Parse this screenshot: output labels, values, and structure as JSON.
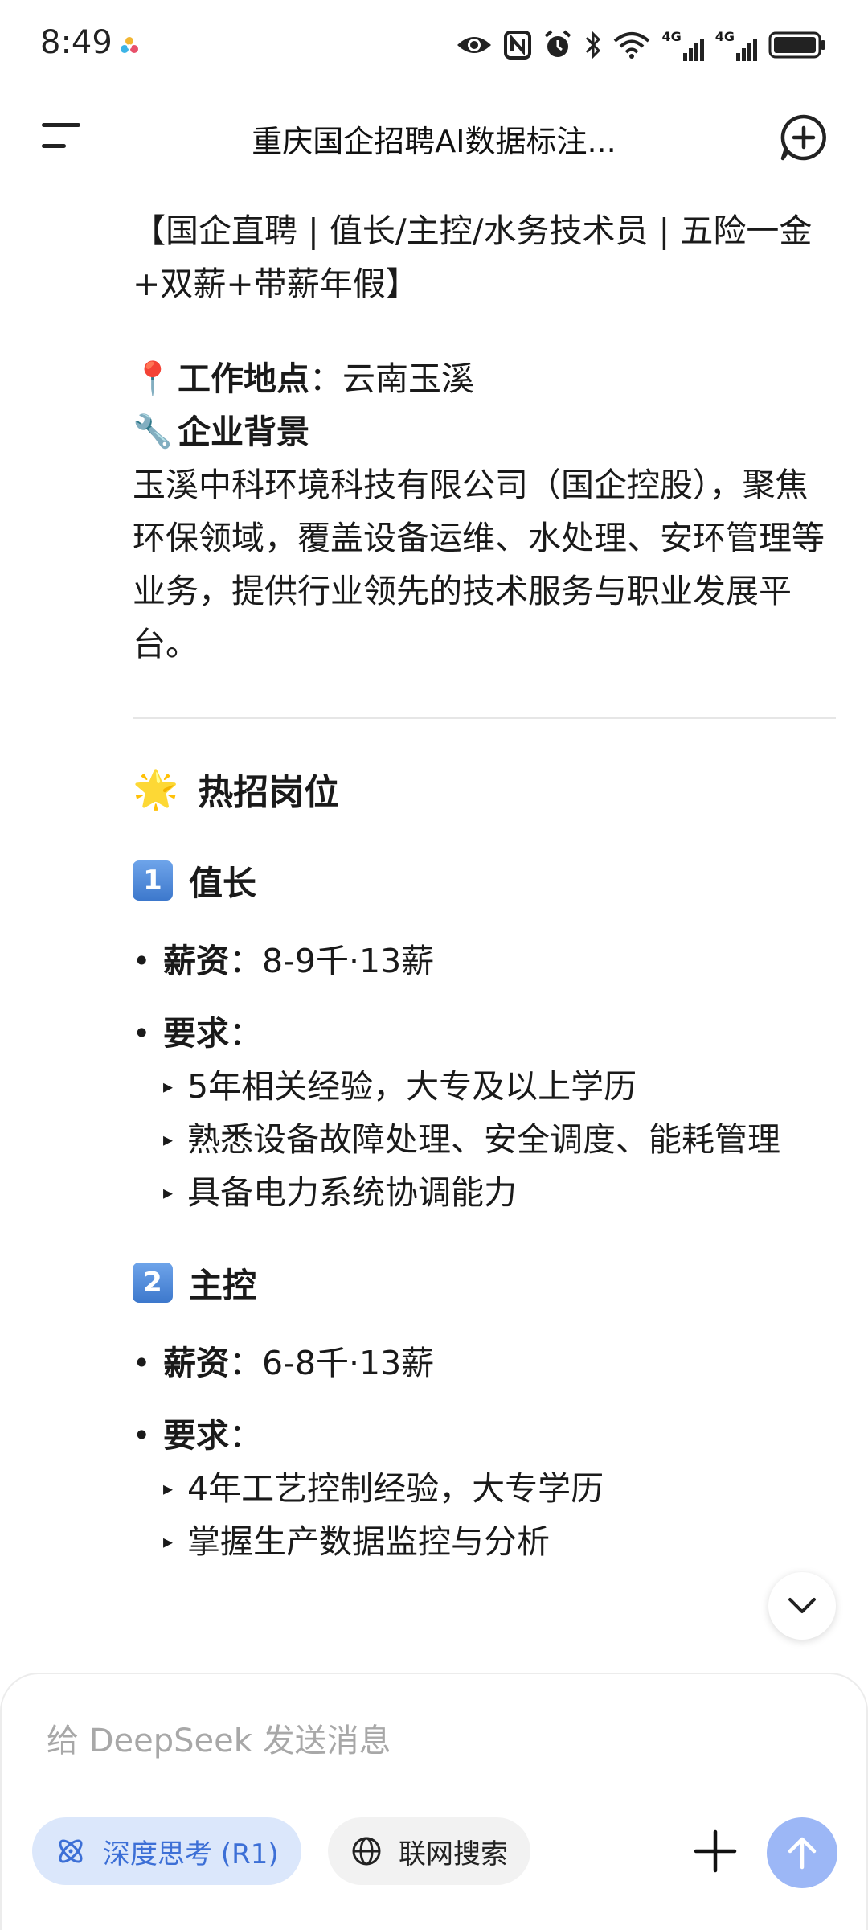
{
  "status_bar": {
    "time": "8:49",
    "icons": [
      "eye-icon",
      "nfc-icon",
      "alarm-icon",
      "bluetooth-icon",
      "wifi-icon",
      "signal-4g-icon",
      "signal-4g-icon",
      "battery-icon"
    ],
    "network_labels": [
      "4G",
      "4G"
    ]
  },
  "header": {
    "title": "重庆国企招聘AI数据标注..."
  },
  "content": {
    "headline": "【国企直聘 | 值长/主控/水务技术员 | 五险一金+双薪+带薪年假】",
    "location_label": "工作地点",
    "location_value": "：云南玉溪",
    "background_label": "企业背景",
    "background_text": "玉溪中科环境科技有限公司（国企控股），聚焦环保领域，覆盖设备运维、水处理、安环管理等业务，提供行业领先的技术服务与职业发展平台。",
    "hot_title": "热招岗位",
    "positions": [
      {
        "num": "1",
        "title": "值长",
        "salary_label": "薪资",
        "salary_value": "：8-9千·13薪",
        "req_label": "要求",
        "req_colon": "：",
        "requirements": [
          "5年相关经验，大专及以上学历",
          "熟悉设备故障处理、安全调度、能耗管理",
          "具备电力系统协调能力"
        ]
      },
      {
        "num": "2",
        "title": "主控",
        "salary_label": "薪资",
        "salary_value": "：6-8千·13薪",
        "req_label": "要求",
        "req_colon": "：",
        "requirements": [
          "4年工艺控制经验，大专学历",
          "掌握生产数据监控与分析"
        ]
      }
    ]
  },
  "input": {
    "placeholder": "给 DeepSeek 发送消息",
    "deep_think_label": "深度思考 (R1)",
    "web_search_label": "联网搜索"
  },
  "colors": {
    "accent": "#3c6fd6",
    "chip_active_bg": "#dbe7fb",
    "send_button": "#9cb7f6",
    "badge": "#4a8ae0"
  }
}
